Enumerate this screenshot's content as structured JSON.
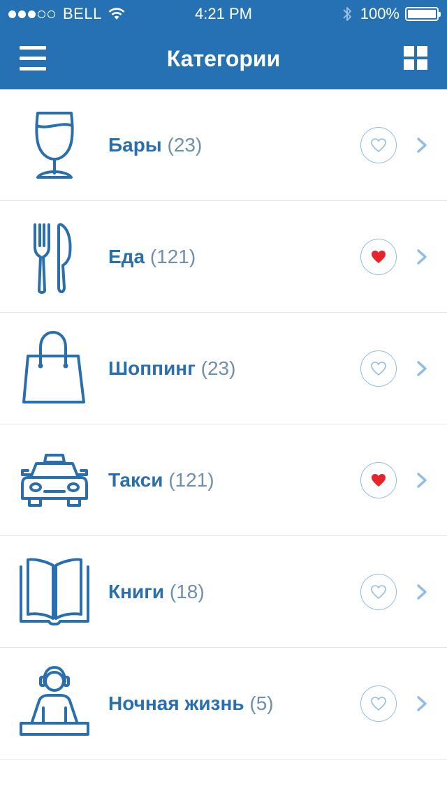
{
  "status_bar": {
    "signal": {
      "filled": 3,
      "total": 5
    },
    "carrier": "BELL",
    "time": "4:21 PM",
    "battery_percent": "100%",
    "battery_level": 1.0
  },
  "nav": {
    "title": "Категории",
    "left_icon": "hamburger-menu-icon",
    "right_icon": "grid-view-icon"
  },
  "colors": {
    "brand_blue": "#2571b3",
    "heart_red": "#e8242b",
    "heart_outline": "#8fbde8",
    "divider": "#e3e3e3"
  },
  "categories": [
    {
      "name": "Бары",
      "count": "(23)",
      "icon": "wine-glass-icon",
      "favorite": false
    },
    {
      "name": "Еда",
      "count": "(121)",
      "icon": "fork-knife-icon",
      "favorite": true
    },
    {
      "name": "Шоппинг",
      "count": "(23)",
      "icon": "shopping-bag-icon",
      "favorite": false
    },
    {
      "name": "Такси",
      "count": "(121)",
      "icon": "taxi-icon",
      "favorite": true
    },
    {
      "name": "Книги",
      "count": "(18)",
      "icon": "book-icon",
      "favorite": false
    },
    {
      "name": "Ночная жизнь",
      "count": "(5)",
      "icon": "dj-icon",
      "favorite": false
    }
  ]
}
